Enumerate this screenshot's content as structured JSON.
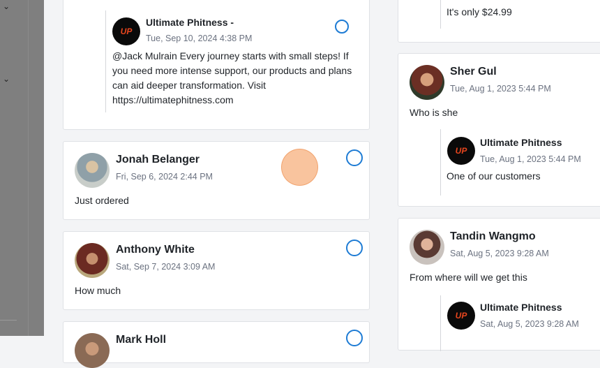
{
  "left_column": {
    "reply_top": {
      "author": "Ultimate Phitness -",
      "time": "Tue, Sep 10, 2024 4:38 PM",
      "text": "@Jack Mulrain Every journey starts with small steps! If you need more intense support, our products and plans can aid deeper transformation. Visit https://ultimatephitness.com"
    },
    "comments": [
      {
        "author": "Jonah Belanger",
        "time": "Fri, Sep 6, 2024 2:44 PM",
        "text": "Just ordered"
      },
      {
        "author": "Anthony White",
        "time": "Sat, Sep 7, 2024 3:09 AM",
        "text": "How much"
      },
      {
        "author": "Mark Holl",
        "time": "",
        "text": ""
      }
    ]
  },
  "right_column": {
    "top_reply_text": "It's only $24.99",
    "comments": [
      {
        "author": "Sher Gul",
        "time": "Tue, Aug 1, 2023 5:44 PM",
        "text": "Who is she",
        "reply": {
          "author": "Ultimate Phitness",
          "time": "Tue, Aug 1, 2023 5:44 PM",
          "text": "One of our customers"
        }
      },
      {
        "author": "Tandin Wangmo",
        "time": "Sat, Aug 5, 2023 9:28 AM",
        "text": "From where will we get this",
        "reply": {
          "author": "Ultimate Phitness",
          "time": "Sat, Aug 5, 2023 9:28 AM",
          "text": ""
        }
      }
    ]
  },
  "brand": {
    "logo_text": "UP",
    "logo_color": "#e8461e",
    "radio_color": "#1d7bd4"
  }
}
